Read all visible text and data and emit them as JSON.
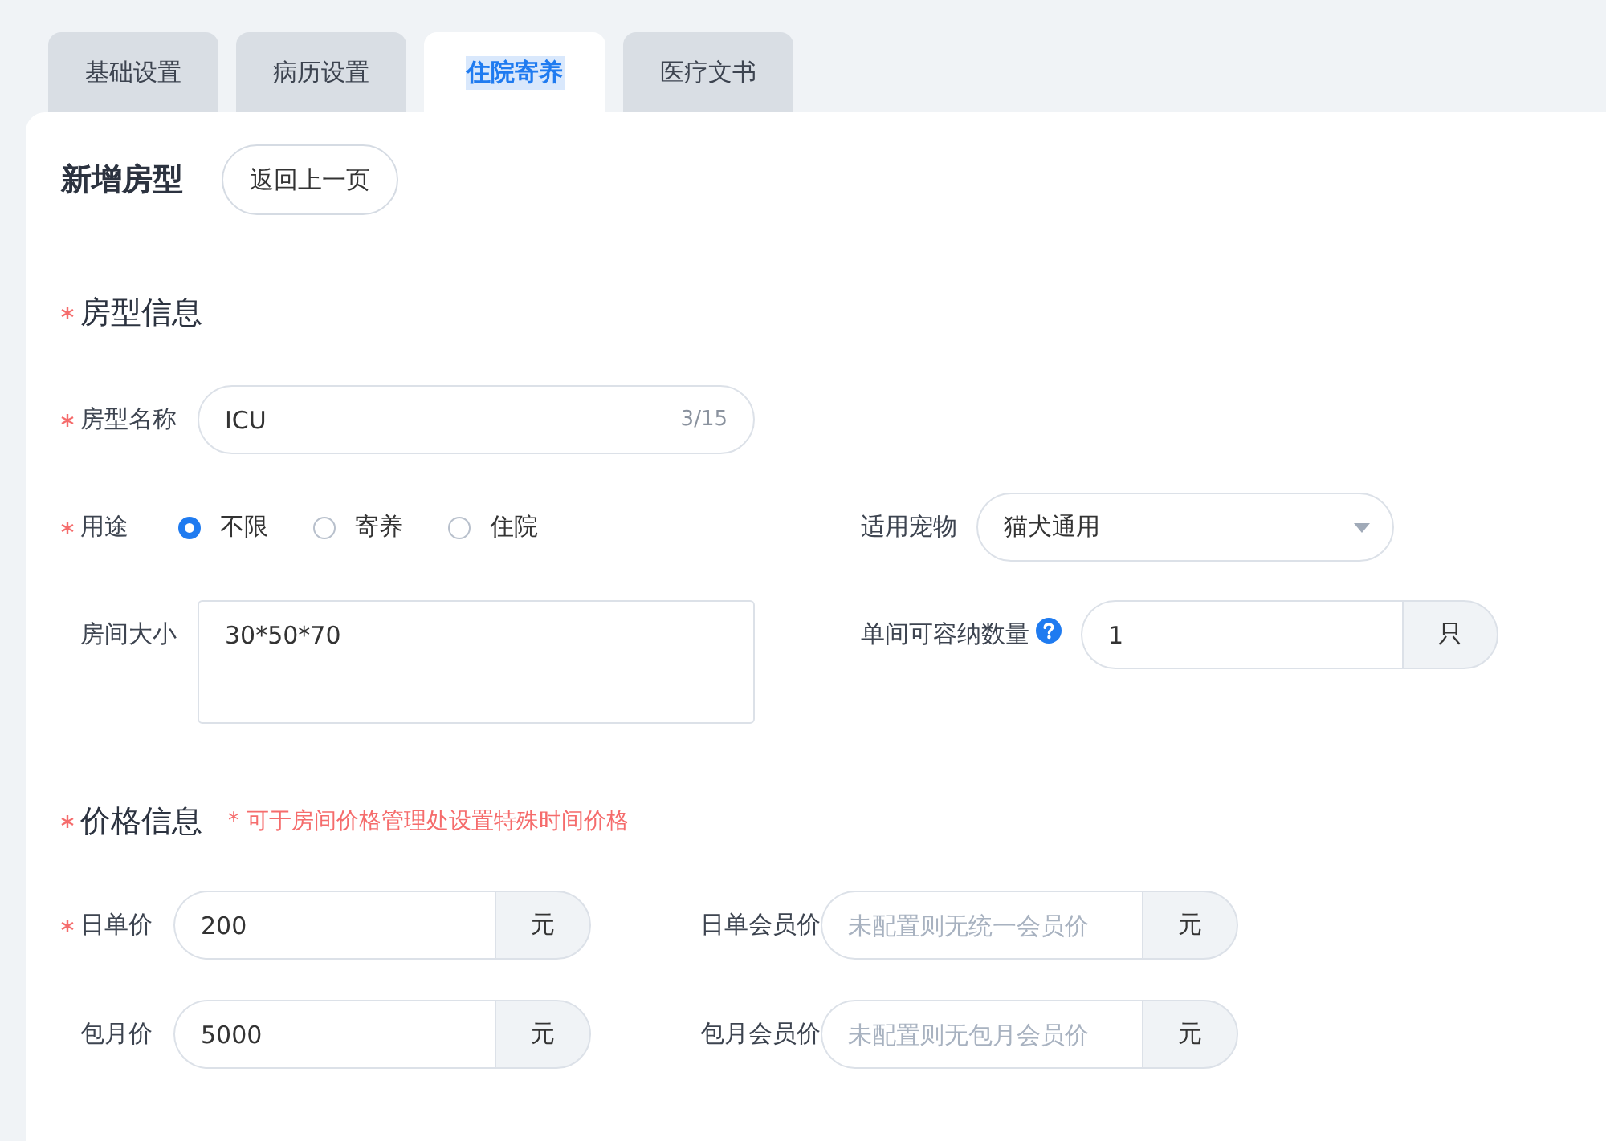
{
  "tabs": [
    {
      "label": "基础设置",
      "selected": false
    },
    {
      "label": "病历设置",
      "selected": false
    },
    {
      "label": "住院寄养",
      "selected": true
    },
    {
      "label": "医疗文书",
      "selected": false
    }
  ],
  "page": {
    "title": "新增房型",
    "back_button": "返回上一页"
  },
  "room_section": {
    "title": "房型信息",
    "required": true
  },
  "name_field": {
    "label": "房型名称",
    "required": true,
    "value": "ICU",
    "counter": "3/15"
  },
  "purpose": {
    "label": "用途",
    "required": true,
    "options": [
      {
        "label": "不限",
        "selected": true
      },
      {
        "label": "寄养",
        "selected": false
      },
      {
        "label": "住院",
        "selected": false
      }
    ]
  },
  "pet_field": {
    "label": "适用宠物",
    "value": "猫犬通用"
  },
  "size_field": {
    "label": "房间大小",
    "required": false,
    "value": "30*50*70"
  },
  "capacity_field": {
    "label": "单间可容纳数量",
    "value": "1",
    "unit": "只"
  },
  "price_section": {
    "title": "价格信息",
    "required": true,
    "note": "* 可于房间价格管理处设置特殊时间价格"
  },
  "prices": [
    {
      "label": "日单价",
      "required": true,
      "value": "200",
      "unit": "元"
    },
    {
      "label": "日单会员价",
      "required": false,
      "placeholder": "未配置则无统一会员价",
      "unit": "元"
    },
    {
      "label": "包月价",
      "required": false,
      "value": "5000",
      "unit": "元"
    },
    {
      "label": "包月会员价",
      "required": false,
      "placeholder": "未配置则无包月会员价",
      "unit": "元"
    }
  ]
}
